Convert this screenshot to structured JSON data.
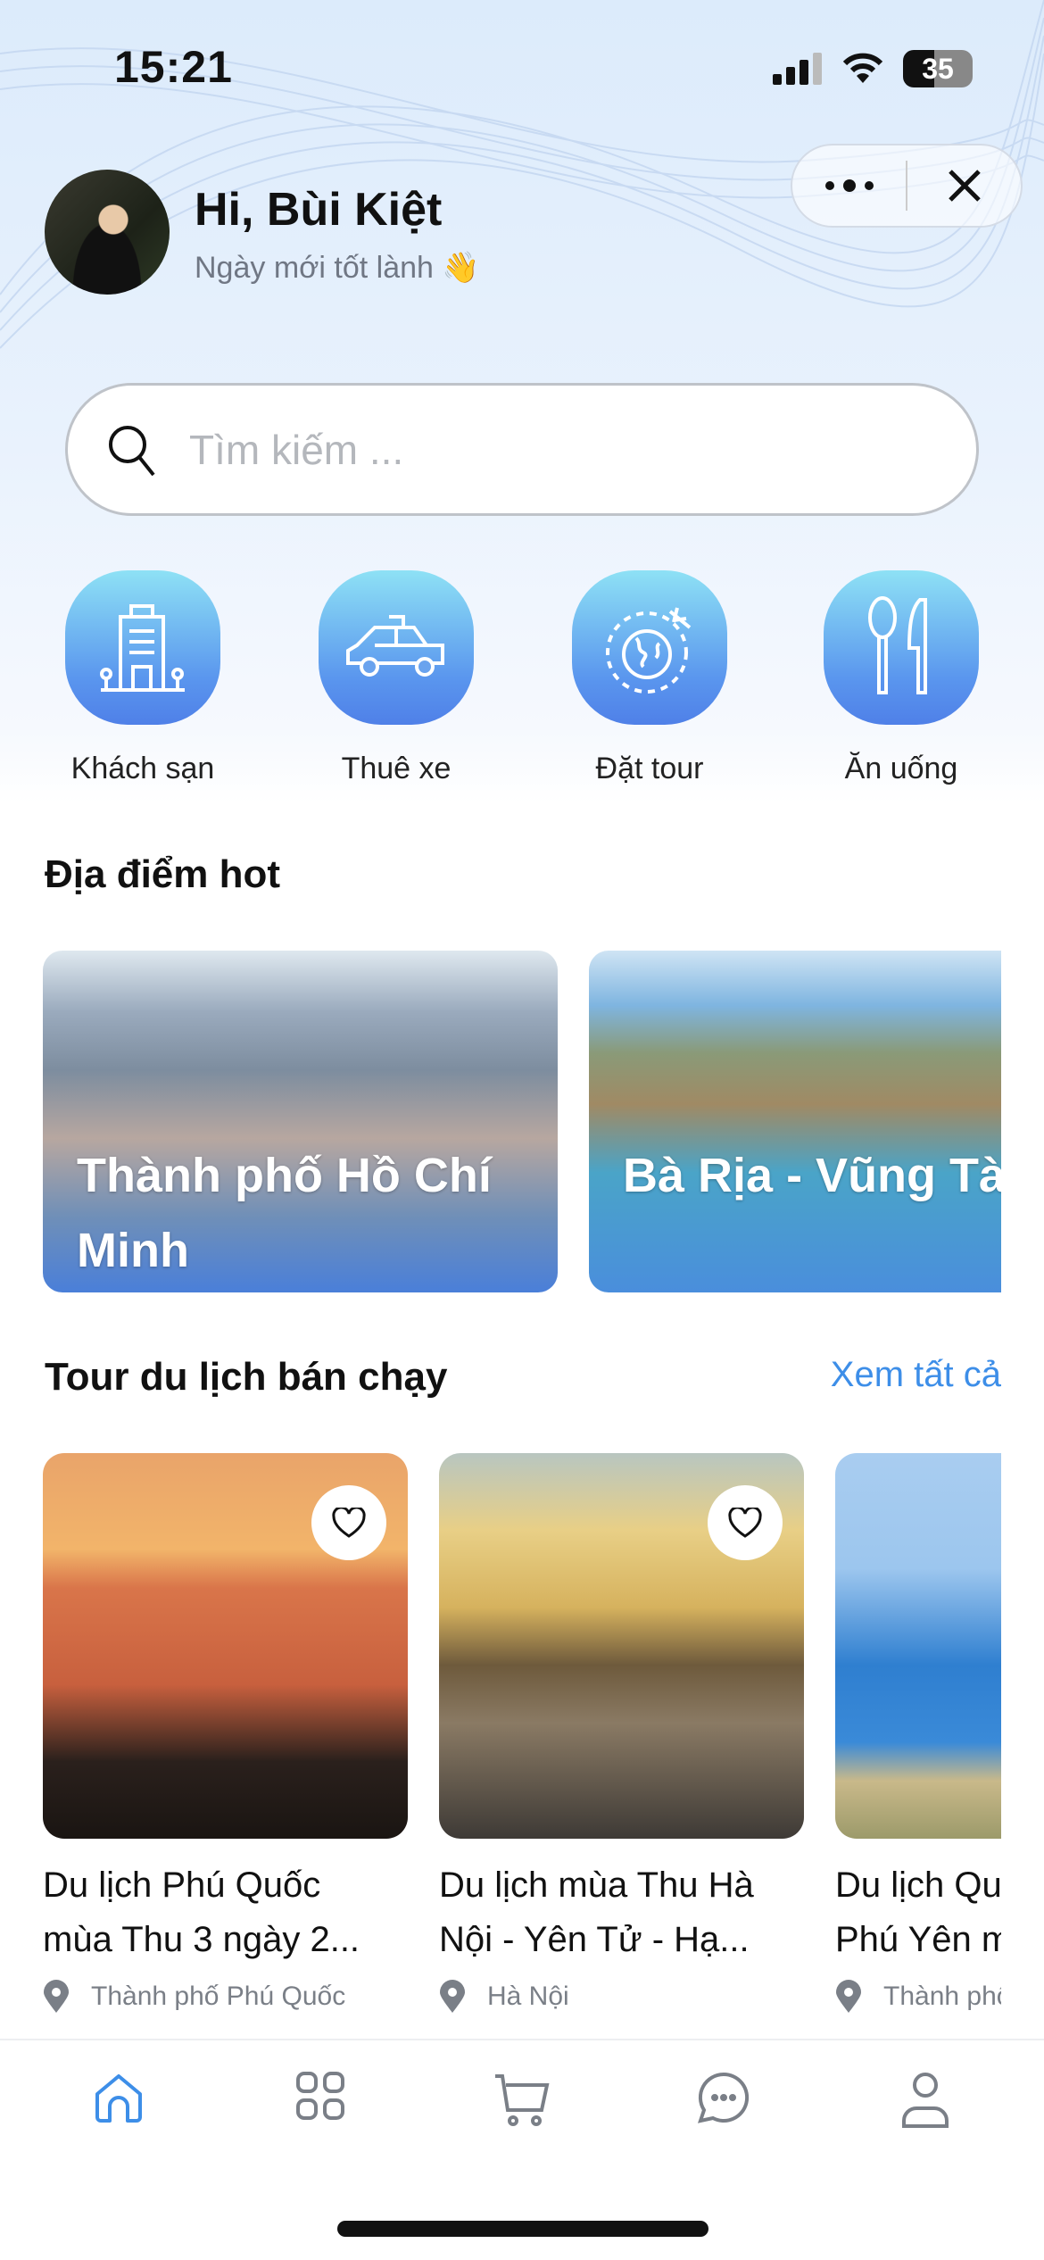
{
  "status_bar": {
    "time": "15:21",
    "battery": "35"
  },
  "header": {
    "greeting": "Hi, Bùi Kiệt",
    "subtitle": "Ngày mới tốt lành 👋"
  },
  "search": {
    "placeholder": "Tìm kiếm ..."
  },
  "categories": [
    {
      "label": "Khách sạn",
      "icon": "hotel-icon"
    },
    {
      "label": "Thuê xe",
      "icon": "car-icon"
    },
    {
      "label": "Đặt tour",
      "icon": "globe-plane-icon"
    },
    {
      "label": "Ăn uống",
      "icon": "utensils-icon"
    }
  ],
  "hot_places": {
    "title": "Địa điểm hot",
    "items": [
      {
        "name": "Thành phố Hồ Chí Minh"
      },
      {
        "name": "Bà Rịa - Vũng Tàu"
      }
    ]
  },
  "best_tours": {
    "title": "Tour du lịch bán chạy",
    "see_all": "Xem tất cả",
    "items": [
      {
        "title_line1": "Du lịch Phú Quốc",
        "title_line2": "mùa Thu 3 ngày 2...",
        "location": "Thành phố Phú Quốc"
      },
      {
        "title_line1": "Du lịch mùa Thu Hà",
        "title_line2": "Nội - Yên Tử - Hạ...",
        "location": "Hà Nội"
      },
      {
        "title_line1": "Du lịch Quy Nhơn",
        "title_line2": "Phú Yên mùa Thu",
        "location": "Thành phố"
      }
    ]
  },
  "tabbar": {
    "items": [
      "home-icon",
      "grid-icon",
      "cart-icon",
      "chat-icon",
      "user-icon"
    ],
    "active_color": "#3d8ee8",
    "inactive_color": "#7a7f87"
  }
}
